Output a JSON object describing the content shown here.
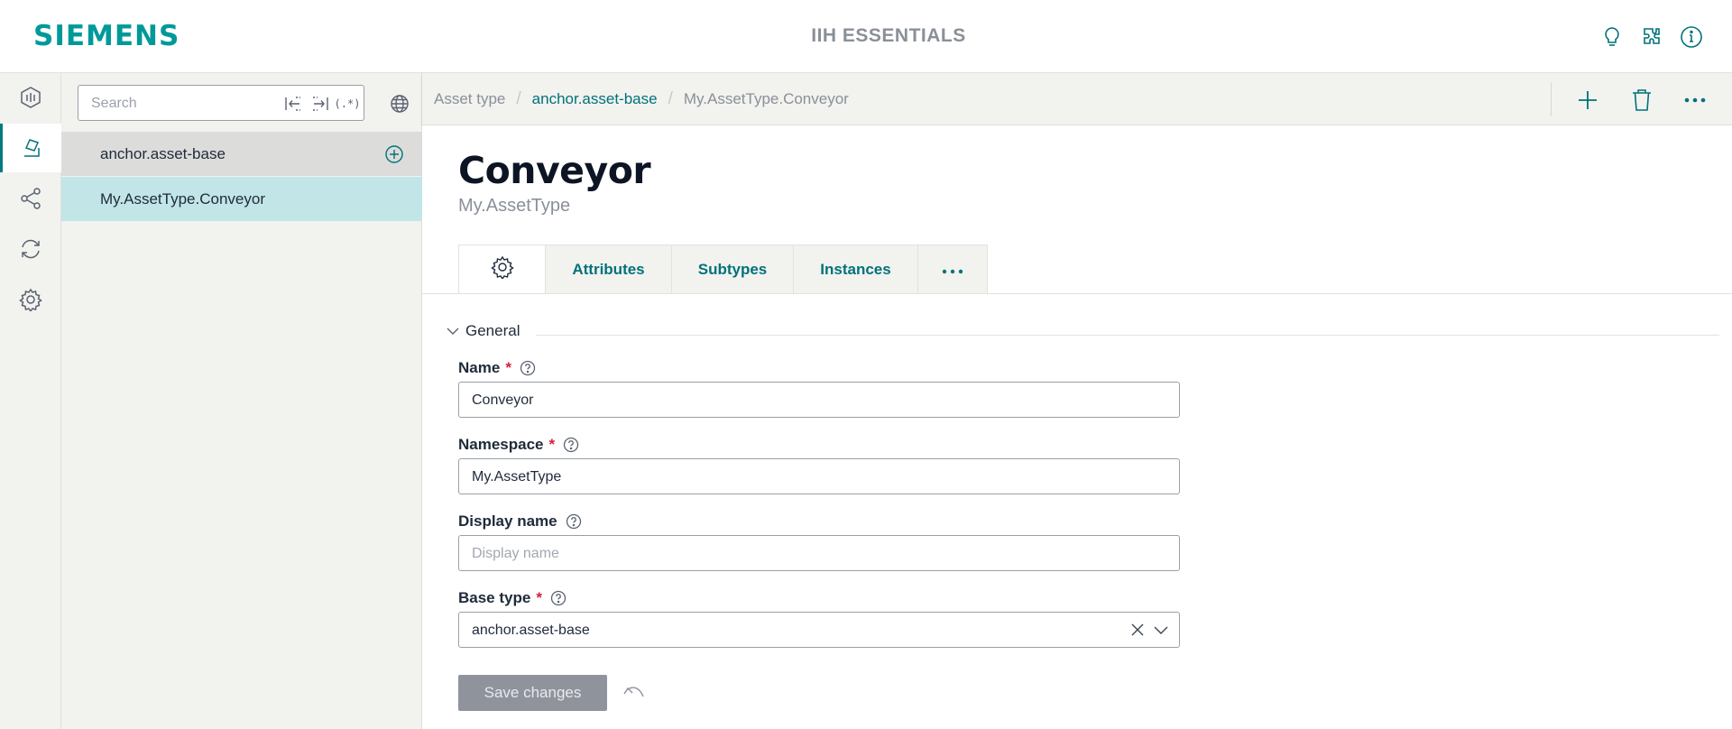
{
  "header": {
    "logo": "SIEMENS",
    "app_title": "IIH ESSENTIALS"
  },
  "icons": {
    "header": [
      "lightbulb-icon",
      "plugin-icon",
      "info-icon"
    ],
    "rail": [
      "dashboard-icon",
      "asset-model-icon",
      "share-icon",
      "sync-icon",
      "settings-icon"
    ]
  },
  "tree": {
    "search_placeholder": "Search",
    "regex_label": "(.*)",
    "items": [
      {
        "label": "anchor.asset-base"
      },
      {
        "label": "My.AssetType.Conveyor"
      }
    ]
  },
  "breadcrumb": {
    "items": [
      "Asset type",
      "anchor.asset-base",
      "My.AssetType.Conveyor"
    ]
  },
  "page": {
    "title": "Conveyor",
    "subtitle": "My.AssetType"
  },
  "tabs": [
    "Attributes",
    "Subtypes",
    "Instances"
  ],
  "form": {
    "section": "General",
    "name_label": "Name",
    "name_value": "Conveyor",
    "namespace_label": "Namespace",
    "namespace_value": "My.AssetType",
    "display_name_label": "Display name",
    "display_name_value": "",
    "display_name_placeholder": "Display name",
    "base_type_label": "Base type",
    "base_type_value": "anchor.asset-base",
    "required_mark": "*",
    "save_label": "Save changes"
  },
  "colors": {
    "brand": "#009999",
    "accent": "#00727a",
    "selected_row": "#c2e6e8",
    "required": "#d4213d"
  }
}
